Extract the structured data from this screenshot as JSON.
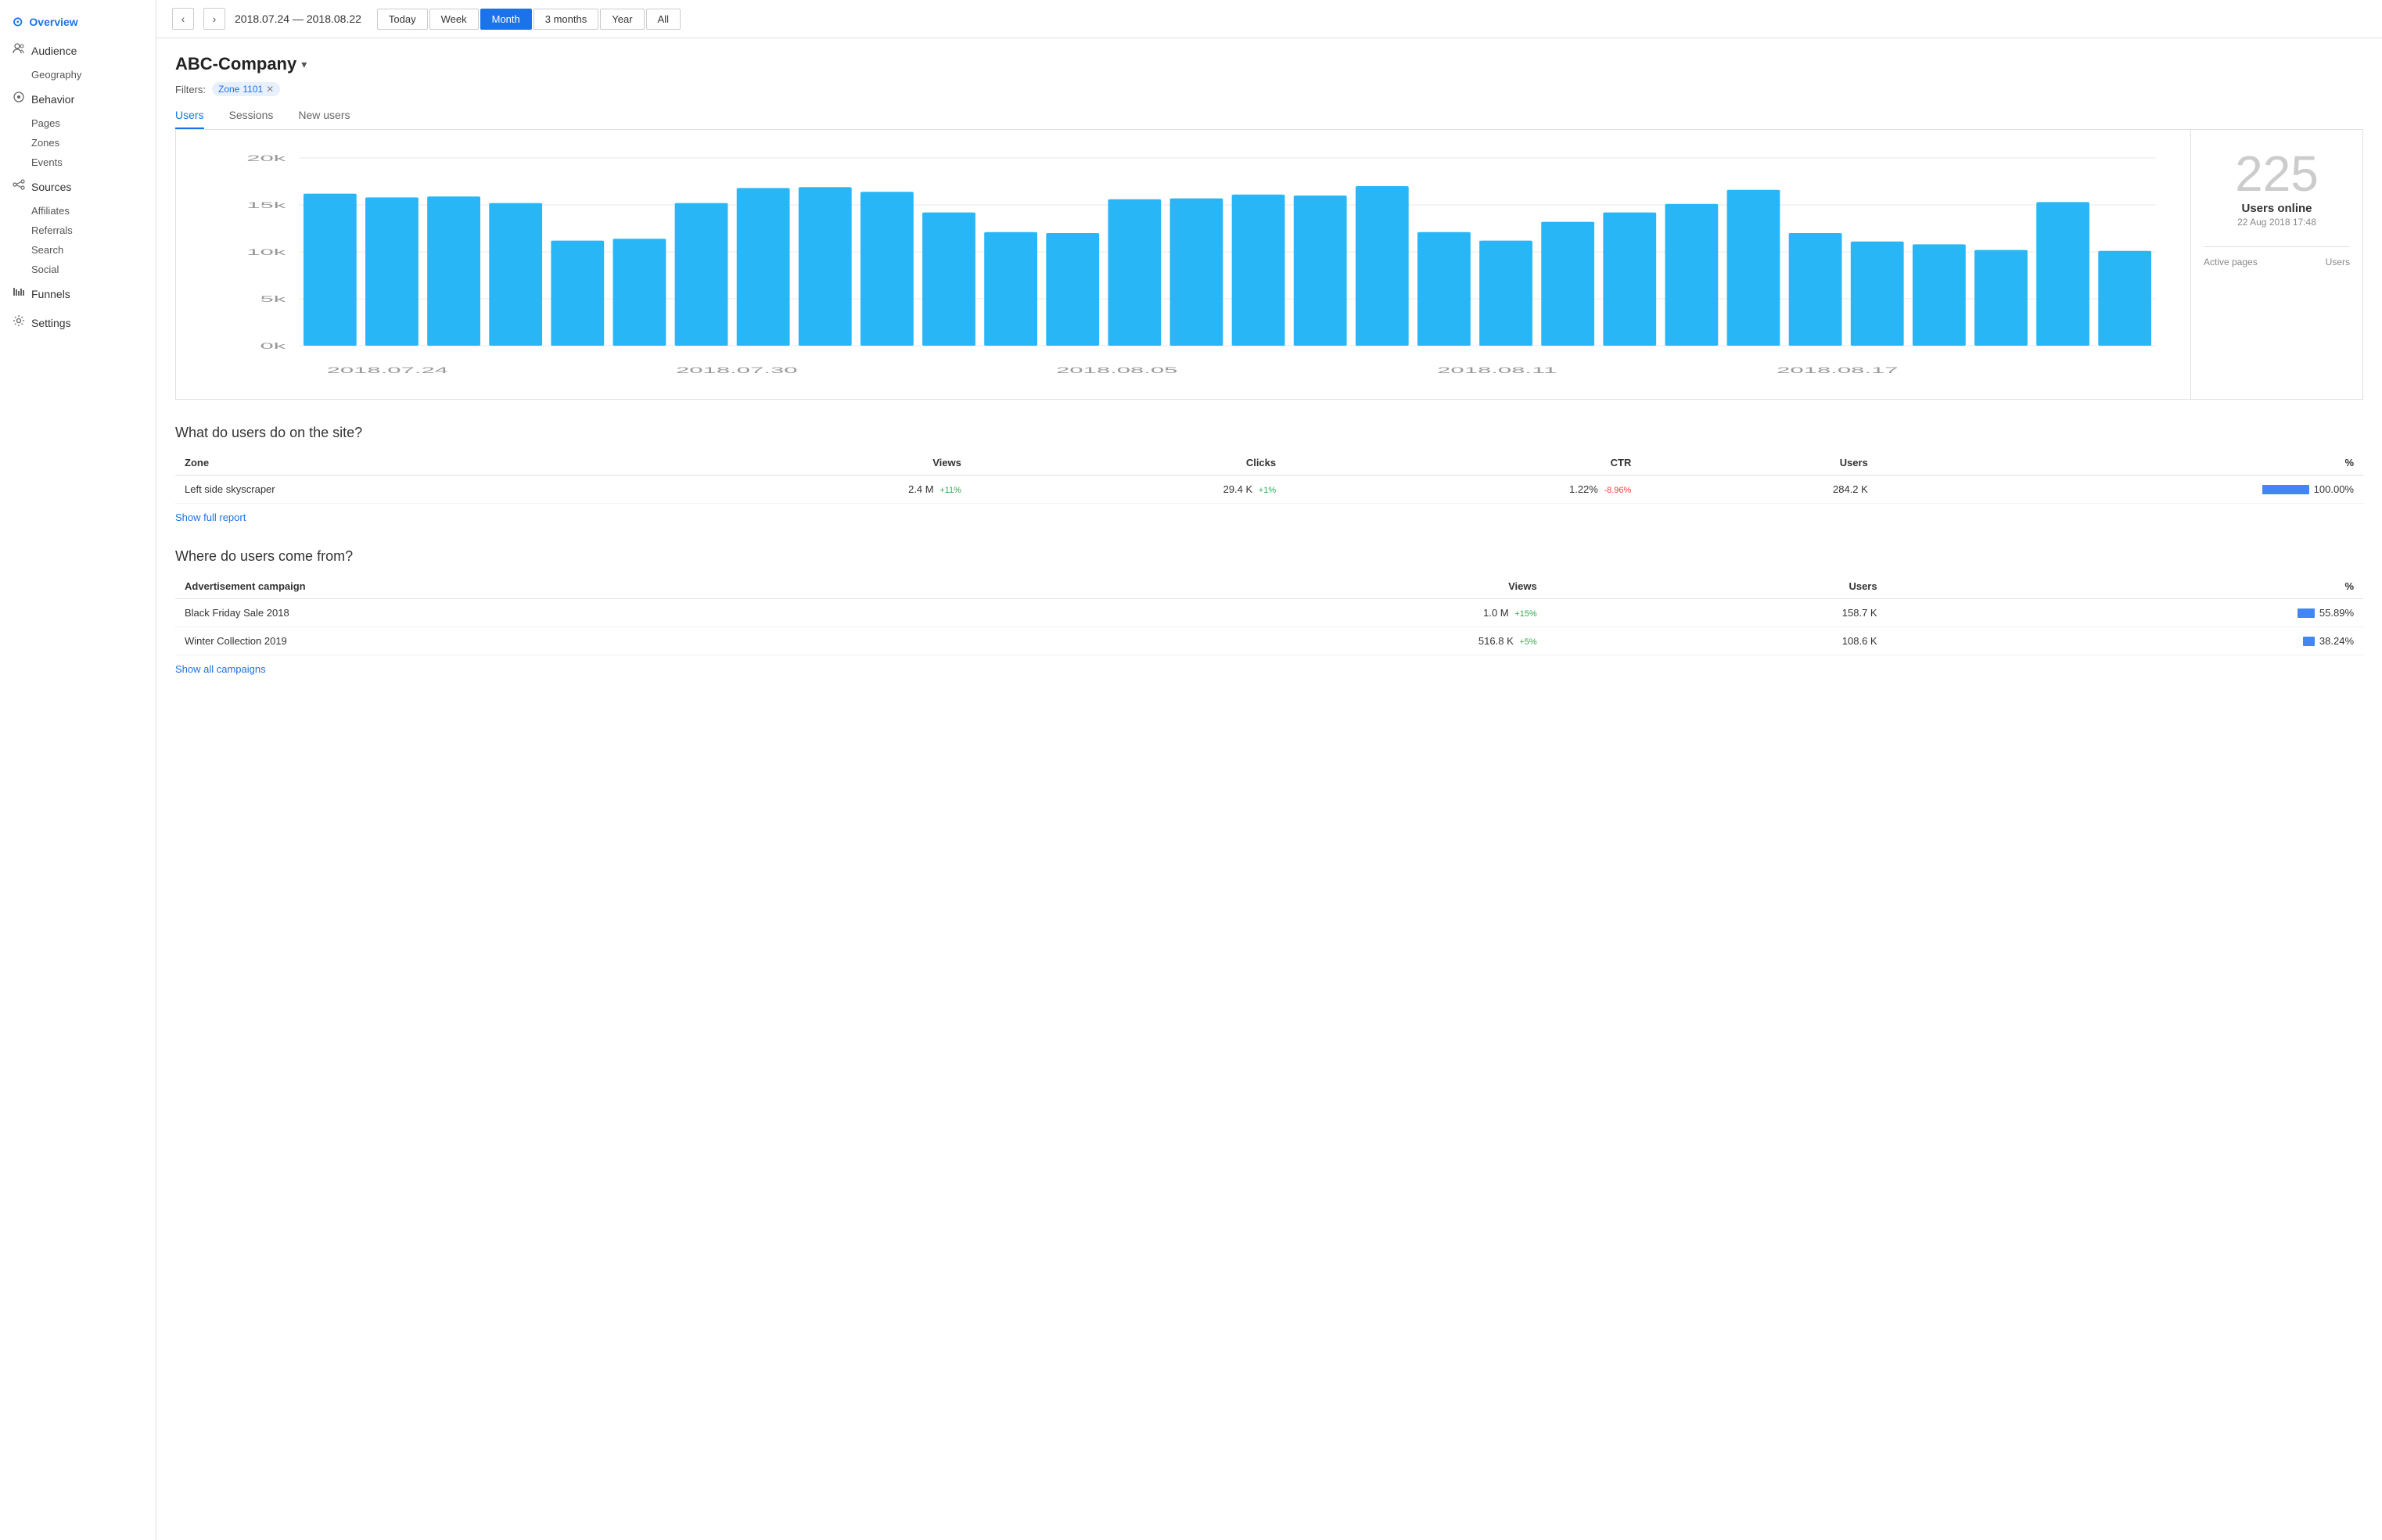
{
  "sidebar": {
    "logo": "⊙",
    "items": [
      {
        "id": "overview",
        "label": "Overview",
        "icon": "⊙",
        "active": true
      },
      {
        "id": "audience",
        "label": "Audience",
        "icon": "👥"
      },
      {
        "id": "geography",
        "label": "Geography",
        "sub": true
      },
      {
        "id": "behavior",
        "label": "Behavior",
        "icon": "🔍"
      },
      {
        "id": "pages",
        "label": "Pages",
        "sub": true
      },
      {
        "id": "zones",
        "label": "Zones",
        "sub": true
      },
      {
        "id": "events",
        "label": "Events",
        "sub": true
      },
      {
        "id": "sources",
        "label": "Sources",
        "icon": "✦"
      },
      {
        "id": "affiliates",
        "label": "Affiliates",
        "sub": true
      },
      {
        "id": "referrals",
        "label": "Referrals",
        "sub": true
      },
      {
        "id": "search",
        "label": "Search",
        "sub": true
      },
      {
        "id": "social",
        "label": "Social",
        "sub": true
      },
      {
        "id": "funnels",
        "label": "Funnels",
        "icon": "📊"
      },
      {
        "id": "settings",
        "label": "Settings",
        "icon": "⚙"
      }
    ]
  },
  "topbar": {
    "prev_label": "‹",
    "next_label": "›",
    "date_range": "2018.07.24 — 2018.08.22",
    "periods": [
      {
        "id": "today",
        "label": "Today"
      },
      {
        "id": "week",
        "label": "Week"
      },
      {
        "id": "month",
        "label": "Month",
        "active": true
      },
      {
        "id": "3months",
        "label": "3 months"
      },
      {
        "id": "year",
        "label": "Year"
      },
      {
        "id": "all",
        "label": "All"
      }
    ]
  },
  "company": {
    "name": "ABC-Company"
  },
  "filters": {
    "label": "Filters:",
    "tags": [
      {
        "name": "Zone",
        "value": "1101"
      }
    ]
  },
  "metric_tabs": [
    {
      "id": "users",
      "label": "Users",
      "active": true
    },
    {
      "id": "sessions",
      "label": "Sessions"
    },
    {
      "id": "new_users",
      "label": "New users"
    }
  ],
  "chart": {
    "y_labels": [
      "20k",
      "15k",
      "10k",
      "5k",
      "0k"
    ],
    "x_labels": [
      "2018.07.24",
      "2018.07.30",
      "2018.08.05",
      "2018.08.11",
      "2018.08.17"
    ],
    "bars": [
      16200,
      15800,
      15900,
      15200,
      11200,
      11400,
      15200,
      16800,
      16900,
      16400,
      14200,
      12100,
      12000,
      15600,
      15700,
      16100,
      16000,
      17000,
      12100,
      11200,
      13200,
      14200,
      15100,
      16600,
      12000,
      11100,
      10800,
      10200,
      15300,
      10100
    ]
  },
  "online": {
    "count": "225",
    "label": "Users online",
    "time": "22 Aug 2018 17:48",
    "active_pages_col": "Active pages",
    "users_col": "Users"
  },
  "zone_section": {
    "heading": "What do users do on the site?",
    "table": {
      "columns": [
        "Zone",
        "Views",
        "Clicks",
        "CTR",
        "Users",
        "%"
      ],
      "rows": [
        {
          "zone": "Left side skyscraper",
          "views": "2.4 M",
          "views_delta": "+11%",
          "views_delta_type": "pos",
          "clicks": "29.4 K",
          "clicks_delta": "+1%",
          "clicks_delta_type": "pos",
          "ctr": "1.22%",
          "ctr_delta": "-8.96%",
          "ctr_delta_type": "neg",
          "users": "284.2 K",
          "bar_pct": 100,
          "pct": "100.00%"
        }
      ]
    },
    "show_link": "Show full report"
  },
  "campaign_section": {
    "heading": "Where do users come from?",
    "table": {
      "columns": [
        "Advertisement campaign",
        "Views",
        "Users",
        "%"
      ],
      "rows": [
        {
          "campaign": "Black Friday Sale 2018",
          "views": "1.0 M",
          "views_delta": "+15%",
          "views_delta_type": "pos",
          "users": "158.7 K",
          "bar_pct": 55.89,
          "pct": "55.89%"
        },
        {
          "campaign": "Winter Collection 2019",
          "views": "516.8 K",
          "views_delta": "+5%",
          "views_delta_type": "pos",
          "users": "108.6 K",
          "bar_pct": 38.24,
          "pct": "38.24%"
        }
      ]
    },
    "show_link": "Show all campaigns"
  }
}
